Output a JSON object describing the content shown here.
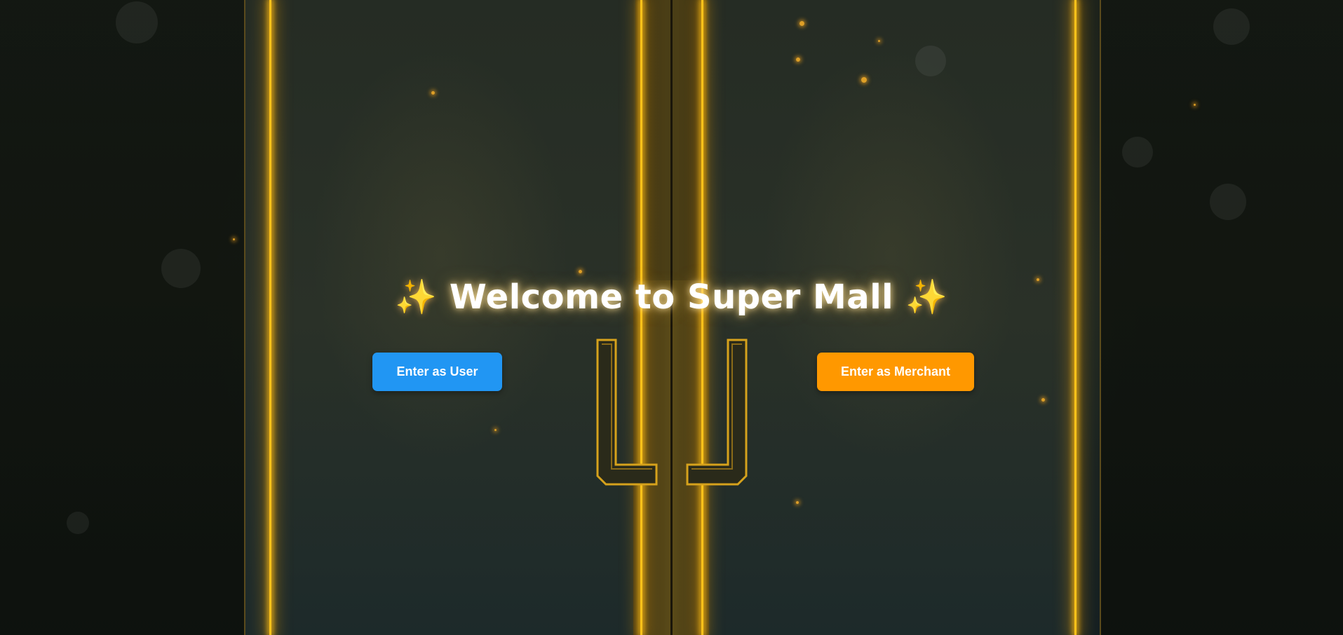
{
  "page": {
    "title_sparkle_left": "✨",
    "title": "Welcome to Super Mall",
    "title_sparkle_right": "✨"
  },
  "actions": {
    "user_button_label": "Enter as User",
    "merchant_button_label": "Enter as Merchant"
  },
  "colors": {
    "user_button": "#2196f3",
    "merchant_button": "#ff9800",
    "glow_accent": "#ffc21a"
  },
  "background": {
    "scene": "golden-glowing-double-door",
    "icons": [
      "door-handle-icon",
      "door-handle-icon",
      "sparkles-icon"
    ]
  }
}
